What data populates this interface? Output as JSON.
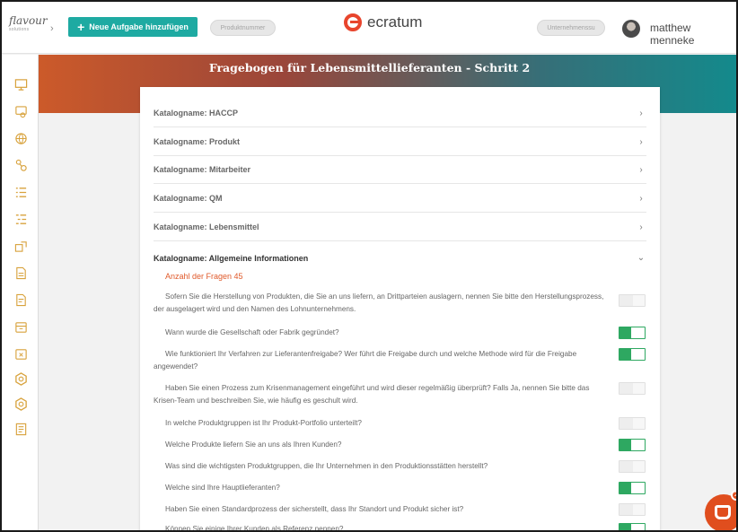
{
  "header": {
    "logo_text": "flavour",
    "logo_tagline": "solutions",
    "crumb_chevron": "›",
    "add_task_label": "Neue Aufgabe hinzufügen",
    "product_number_placeholder": "Produktnummer",
    "center_brand": "ecratum",
    "company_placeholder": "Unternehmenssu",
    "user_name": "matthew menneke"
  },
  "sidebar": {
    "icons": [
      "monitor-icon",
      "certificate-icon",
      "globe-icon",
      "network-icon",
      "list-icon",
      "tree-list-icon",
      "forward-icon",
      "document-icon",
      "document-edit-icon",
      "package-icon",
      "package-x-icon",
      "hexagon-icon",
      "hexagon-alt-icon",
      "report-icon"
    ]
  },
  "banner": {
    "title": "Fragebogen für Lebensmittellieferanten - Schritt 2"
  },
  "catalogs": [
    {
      "label": "Katalogname: HACCP",
      "chevron": "›",
      "open": false
    },
    {
      "label": "Katalogname: Produkt",
      "chevron": "›",
      "open": false
    },
    {
      "label": "Katalogname: Mitarbeiter",
      "chevron": "›",
      "open": false
    },
    {
      "label": "Katalogname: QM",
      "chevron": "›",
      "open": false
    },
    {
      "label": "Katalogname: Lebensmittel",
      "chevron": "›",
      "open": false
    },
    {
      "label": "Katalogname: Allgemeine Informationen",
      "chevron": "⌄",
      "open": true
    }
  ],
  "open_catalog": {
    "question_count_label": "Anzahl der Fragen 45",
    "questions": [
      {
        "text": "Sofern Sie die Herstellung von Produkten, die Sie an uns liefern, an Drittparteien auslagern, nennen Sie bitte den Herstellungsprozess, der ausgelagert wird und den Namen des Lohnunternehmens.",
        "enabled": false
      },
      {
        "text": "Wann wurde die Gesellschaft oder Fabrik gegründet?",
        "enabled": true
      },
      {
        "text": "Wie funktioniert Ihr Verfahren zur Lieferantenfreigabe? Wer führt die Freigabe durch und welche Methode wird für die Freigabe angewendet?",
        "enabled": true
      },
      {
        "text": "Haben Sie einen Prozess zum Krisenmanagement eingeführt und wird dieser regelmäßig überprüft? Falls Ja, nennen Sie bitte das Krisen-Team und beschreiben Sie, wie häufig es geschult wird.",
        "enabled": false
      },
      {
        "text": "In welche Produktgruppen ist Ihr Produkt-Portfolio unterteilt?",
        "enabled": false
      },
      {
        "text": "Welche Produkte liefern Sie an uns als Ihren Kunden?",
        "enabled": true
      },
      {
        "text": "Was sind die wichtigsten Produktgruppen, die Ihr Unternehmen in den Produktionsstätten herstellt?",
        "enabled": false
      },
      {
        "text": "Welche sind Ihre Hauptlieferanten?",
        "enabled": true
      },
      {
        "text": "Haben Sie einen Standardprozess der sicherstellt, dass Ihr Standort und Produkt sicher ist?",
        "enabled": false
      },
      {
        "text": "Können Sie einige Ihrer Kunden als Referenz nennen?",
        "enabled": true
      }
    ]
  },
  "chat": {
    "badge_count": "2"
  },
  "colors": {
    "accent_teal": "#1eaaa2",
    "accent_orange": "#e05a2b",
    "toggle_on": "#2ea861",
    "sidebar_icon": "#d8a23c"
  }
}
